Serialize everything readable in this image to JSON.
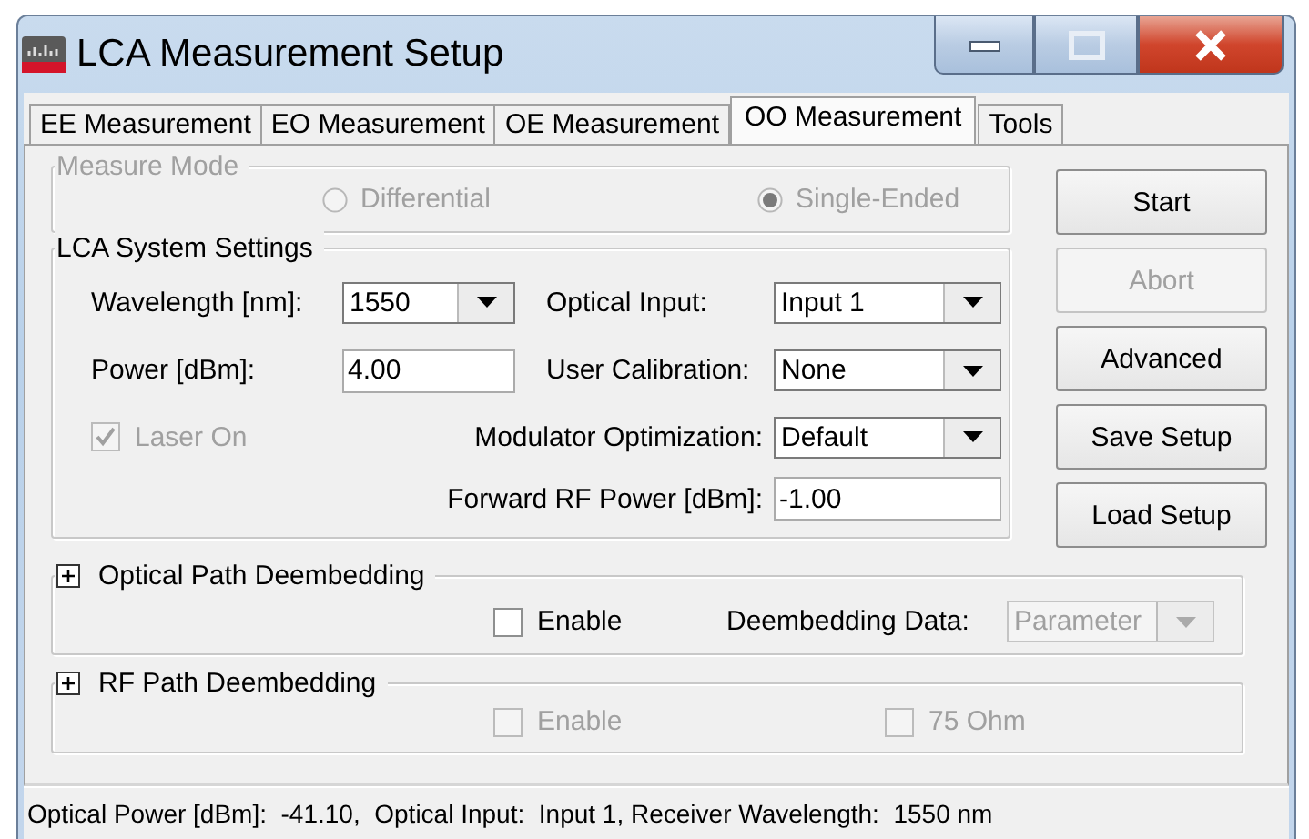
{
  "window": {
    "title": "LCA Measurement Setup"
  },
  "tabs": [
    {
      "label": "EE Measurement",
      "selected": false
    },
    {
      "label": "EO Measurement",
      "selected": false
    },
    {
      "label": "OE Measurement",
      "selected": false
    },
    {
      "label": "OO Measurement",
      "selected": true
    },
    {
      "label": "Tools",
      "selected": false
    }
  ],
  "measure_mode": {
    "label": "Measure Mode",
    "disabled": true,
    "options": [
      {
        "label": "Differential",
        "selected": false
      },
      {
        "label": "Single-Ended",
        "selected": true
      }
    ]
  },
  "system_settings": {
    "label": "LCA System Settings",
    "left": [
      {
        "kind": "combo",
        "label": "Wavelength [nm]:",
        "value": "1550"
      },
      {
        "kind": "input",
        "label": "Power [dBm]:",
        "value": "4.00"
      },
      {
        "kind": "checkbox",
        "label": "Laser On",
        "checked": true,
        "disabled": true
      }
    ],
    "right": [
      {
        "kind": "combo",
        "label": "Optical Input:",
        "value": "Input 1"
      },
      {
        "kind": "combo",
        "label": "User Calibration:",
        "value": "None"
      },
      {
        "kind": "combo",
        "label": "Modulator Optimization:",
        "value": "Default"
      },
      {
        "kind": "input",
        "label": "Forward RF Power [dBm]:",
        "value": "-1.00"
      }
    ]
  },
  "buttons": [
    {
      "label": "Start",
      "disabled": false
    },
    {
      "label": "Abort",
      "disabled": true
    },
    {
      "label": "Advanced",
      "disabled": false
    },
    {
      "label": "Save Setup",
      "disabled": false
    },
    {
      "label": "Load Setup",
      "disabled": false
    }
  ],
  "optical_path": {
    "label": "Optical Path Deembedding",
    "expanded": false,
    "items": [
      {
        "kind": "checkbox",
        "label": "Enable",
        "checked": false,
        "disabled": false
      },
      {
        "kind": "combo",
        "label": "Deembedding Data:",
        "value": "Parameter",
        "disabled": true
      }
    ]
  },
  "rf_path": {
    "label": "RF Path Deembedding",
    "expanded": false,
    "items": [
      {
        "kind": "checkbox",
        "label": "Enable",
        "checked": false,
        "disabled": true
      },
      {
        "kind": "checkbox",
        "label": "75 Ohm",
        "checked": false,
        "disabled": true
      }
    ]
  },
  "status_bar": "Optical Power [dBm]:  -41.10,  Optical Input:  Input 1, Receiver Wavelength:  1550 nm"
}
